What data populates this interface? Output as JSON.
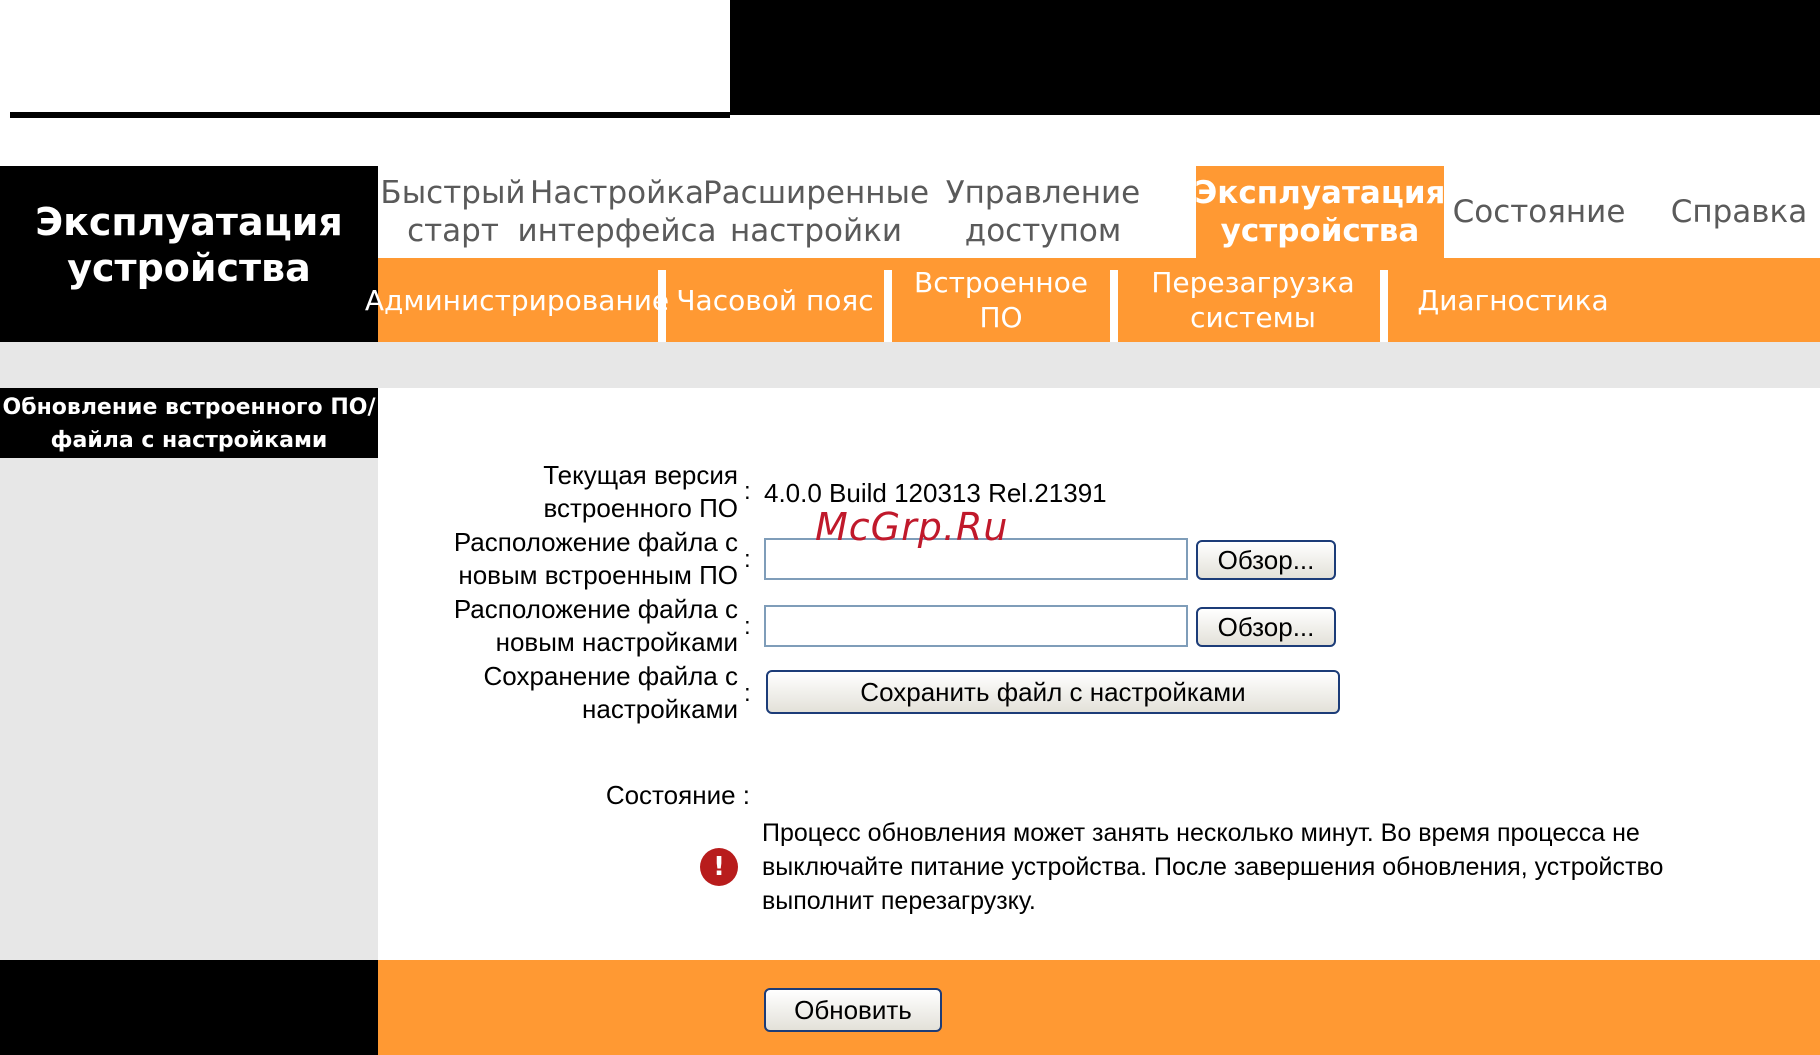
{
  "brand": {
    "title": "Эксплуатация устройства"
  },
  "main_nav": [
    {
      "label": "Быстрый старт"
    },
    {
      "label": "Настройка интерфейса"
    },
    {
      "label": "Расширенные настройки"
    },
    {
      "label": "Управление доступом"
    },
    {
      "label": "Эксплуатация устройства",
      "active": true
    },
    {
      "label": "Состояние"
    },
    {
      "label": "Справка"
    }
  ],
  "sub_nav": [
    {
      "label": "Администрирование"
    },
    {
      "label": "Часовой пояс"
    },
    {
      "label": "Встроенное ПО"
    },
    {
      "label": "Перезагрузка системы"
    },
    {
      "label": "Диагностика"
    }
  ],
  "section": {
    "title": "Обновление встроенного ПО/файла с настройками"
  },
  "form": {
    "current_version_label": "Текущая версия встроенного ПО",
    "current_version_value": "4.0.0 Build 120313 Rel.21391",
    "firmware_file_label": "Расположение файла с новым встроенным ПО",
    "firmware_file_value": "",
    "config_file_label": "Расположение файла с новым настройками",
    "config_file_value": "",
    "browse_label": "Обзор...",
    "save_config_label": "Сохранение файла с настройками",
    "save_config_button": "Сохранить файл с настройками",
    "status_label": "Состояние :",
    "status_message": "Процесс обновления может занять несколько минут. Во время процесса не выключайте питание устройства. После завершения обновления, устройство выполнит перезагрузку.",
    "colon": ":"
  },
  "footer": {
    "update_button": "Обновить"
  },
  "watermark": "McGrp.Ru",
  "colors": {
    "accent": "#ff9933",
    "black": "#000000",
    "gray": "#e7e7e7",
    "warn": "#b81c1c"
  }
}
